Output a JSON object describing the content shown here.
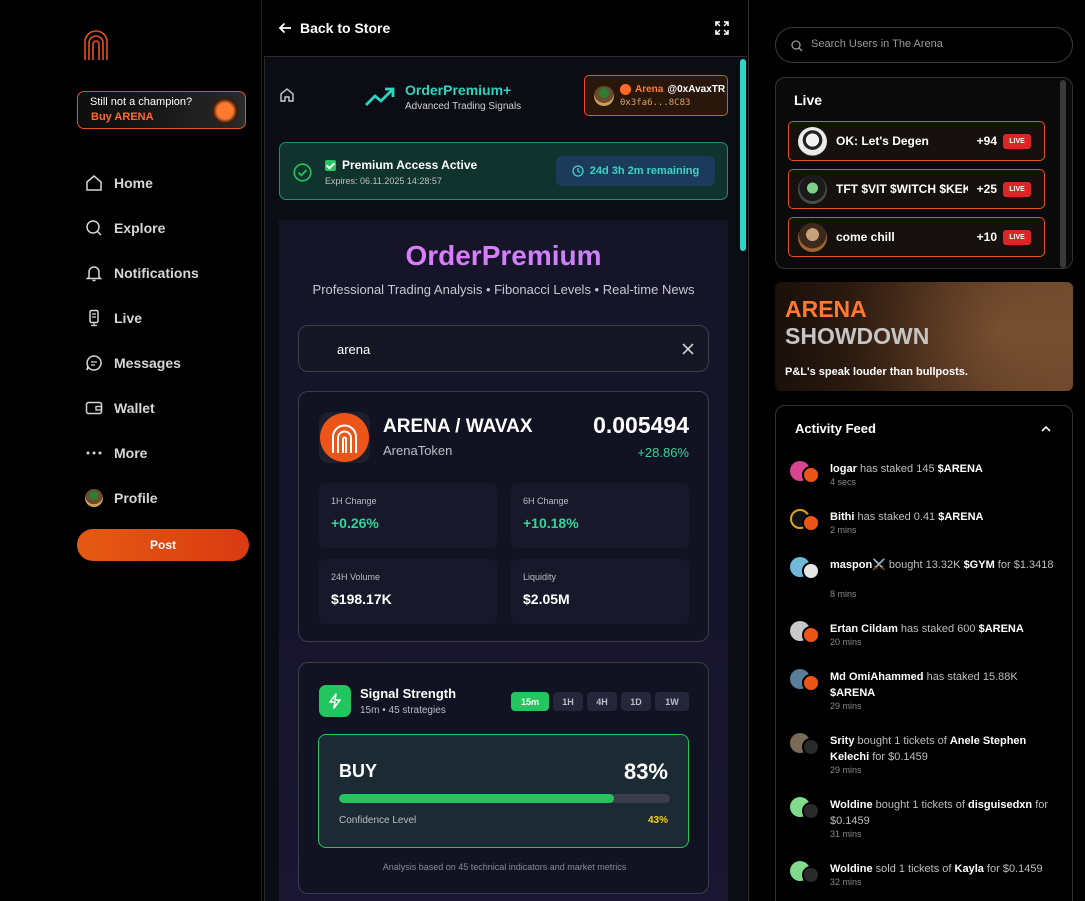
{
  "sidebar": {
    "promo_line1": "Still not a champion?",
    "promo_line2": "Buy ARENA",
    "nav": {
      "home": "Home",
      "explore": "Explore",
      "notifications": "Notifications",
      "live": "Live",
      "messages": "Messages",
      "wallet": "Wallet",
      "more": "More",
      "profile": "Profile"
    },
    "post_label": "Post"
  },
  "center": {
    "back_label": "Back to Store",
    "brand_name": "OrderPremium+",
    "brand_sub": "Advanced Trading Signals",
    "wallet_name": "Arena",
    "wallet_handle": "@0xAvaxTR",
    "wallet_addr": "0x3fa6...8C83",
    "access_title": "Premium Access Active",
    "access_expires": "Expires: 06.11.2025 14:28:57",
    "access_remaining": "24d 3h 2m remaining",
    "hero_title": "OrderPremium",
    "hero_sub": "Professional Trading Analysis • Fibonacci Levels • Real-time News",
    "search_value": "arena",
    "pair": {
      "name": "ARENA / WAVAX",
      "token": "ArenaToken",
      "price": "0.005494",
      "change": "+28.86%",
      "stats": [
        {
          "label": "1H Change",
          "value": "+0.26%"
        },
        {
          "label": "6H Change",
          "value": "+10.18%"
        },
        {
          "label": "24H Volume",
          "value": "$198.17K"
        },
        {
          "label": "Liquidity",
          "value": "$2.05M"
        }
      ]
    },
    "signal": {
      "title": "Signal Strength",
      "sub": "15m • 45 strategies",
      "timeframes": [
        "15m",
        "1H",
        "4H",
        "1D",
        "1W"
      ],
      "active_timeframe": "15m",
      "action": "BUY",
      "strength_label": "83%",
      "strength_fraction": 0.83,
      "confidence_label": "Confidence Level",
      "confidence_value": "43%",
      "footer": "Analysis based on 45 technical indicators and market metrics"
    }
  },
  "right": {
    "search_placeholder": "Search Users in The Arena",
    "live_title": "Live",
    "live_items": [
      {
        "name": "OK: Let's Degen",
        "count": "+94",
        "tag": "LIVE"
      },
      {
        "name": "TFT $VIT $WITCH $KEKW",
        "count": "+25",
        "tag": "LIVE"
      },
      {
        "name": "come chill",
        "count": "+10",
        "tag": "LIVE"
      }
    ],
    "banner_line1": "ARENA",
    "banner_line2": "SHOWDOWN",
    "banner_line3": "P&L's speak louder than bullposts.",
    "feed_title": "Activity Feed",
    "feed": [
      {
        "user": "logar",
        "action": " has staked 145 ",
        "object": "$ARENA",
        "rest": "",
        "time": "4 secs"
      },
      {
        "user": "Bithi",
        "action": " has staked 0.41 ",
        "object": "$ARENA",
        "rest": "",
        "time": "2 mins"
      },
      {
        "user": "maspon⚔️",
        "action": " bought 13.32K ",
        "object": "$GYM",
        "rest": " for $1.3418",
        "time": "8 mins"
      },
      {
        "user": "Ertan Cildam",
        "action": " has staked 600 ",
        "object": "$ARENA",
        "rest": "",
        "time": "20 mins"
      },
      {
        "user": "Md OmiAhammed",
        "action": " has staked 15.88K ",
        "object": "$ARENA",
        "rest": "",
        "time": "29 mins"
      },
      {
        "user": "Srity",
        "action": " bought 1 tickets of ",
        "object": "Anele Stephen Kelechi",
        "rest": " for $0.1459",
        "time": "29 mins"
      },
      {
        "user": "Woldine",
        "action": " bought 1 tickets of ",
        "object": "disguisedxn",
        "rest": " for $0.1459",
        "time": "31 mins"
      },
      {
        "user": "Woldine",
        "action": " sold 1 tickets of ",
        "object": "Kayla",
        "rest": " for $0.1459",
        "time": "32 mins"
      }
    ]
  },
  "colors": {
    "accent_orange": "#e5531f",
    "accent_teal": "#2dd4bf",
    "success_green": "#22c55e",
    "live_red": "#dc2626",
    "confidence_yellow": "#facc15"
  }
}
